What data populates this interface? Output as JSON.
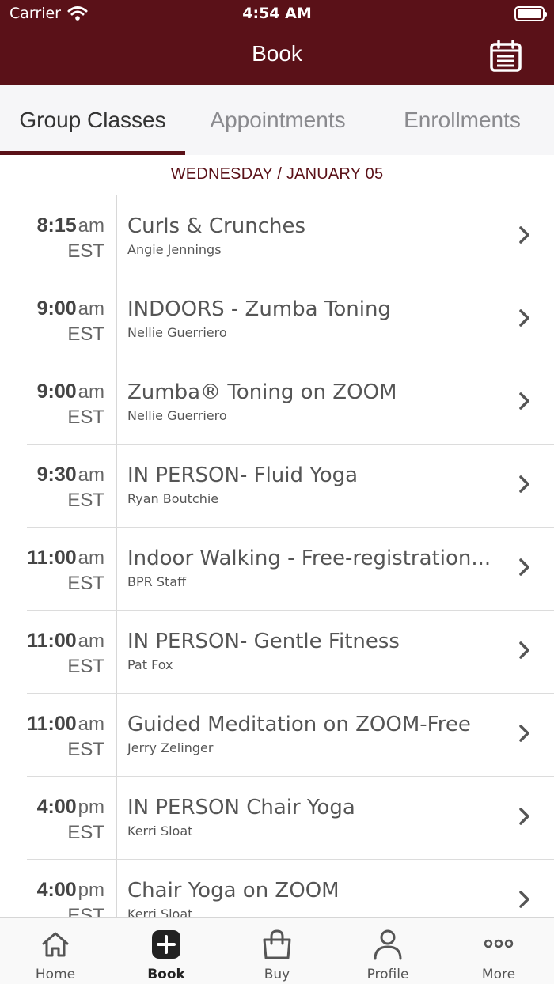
{
  "status_bar": {
    "carrier": "Carrier",
    "time": "4:54 AM"
  },
  "nav": {
    "title": "Book"
  },
  "tabs": [
    {
      "label": "Group Classes",
      "active": true
    },
    {
      "label": "Appointments",
      "active": false
    },
    {
      "label": "Enrollments",
      "active": false
    }
  ],
  "date_label": "WEDNESDAY / JANUARY 05",
  "classes": [
    {
      "time": "8:15",
      "ampm": "am",
      "tz": "EST",
      "name": "Curls & Crunches",
      "instructor": "Angie Jennings"
    },
    {
      "time": "9:00",
      "ampm": "am",
      "tz": "EST",
      "name": "INDOORS - Zumba Toning",
      "instructor": "Nellie Guerriero"
    },
    {
      "time": "9:00",
      "ampm": "am",
      "tz": "EST",
      "name": "Zumba® Toning on ZOOM",
      "instructor": "Nellie Guerriero"
    },
    {
      "time": "9:30",
      "ampm": "am",
      "tz": "EST",
      "name": "IN PERSON- Fluid Yoga",
      "instructor": "Ryan Boutchie"
    },
    {
      "time": "11:00",
      "ampm": "am",
      "tz": "EST",
      "name": "Indoor Walking - Free-registration...",
      "instructor": "BPR Staff"
    },
    {
      "time": "11:00",
      "ampm": "am",
      "tz": "EST",
      "name": "IN PERSON- Gentle Fitness",
      "instructor": "Pat Fox"
    },
    {
      "time": "11:00",
      "ampm": "am",
      "tz": "EST",
      "name": "Guided Meditation on ZOOM-Free",
      "instructor": "Jerry Zelinger"
    },
    {
      "time": "4:00",
      "ampm": "pm",
      "tz": "EST",
      "name": "IN PERSON Chair Yoga",
      "instructor": "Kerri Sloat"
    },
    {
      "time": "4:00",
      "ampm": "pm",
      "tz": "EST",
      "name": "Chair Yoga on ZOOM",
      "instructor": "Kerri Sloat"
    }
  ],
  "tabbar": [
    {
      "label": "Home",
      "icon": "home-icon",
      "active": false
    },
    {
      "label": "Book",
      "icon": "plus-square-icon",
      "active": true
    },
    {
      "label": "Buy",
      "icon": "shopping-bag-icon",
      "active": false
    },
    {
      "label": "Profile",
      "icon": "person-icon",
      "active": false
    },
    {
      "label": "More",
      "icon": "more-dots-icon",
      "active": false
    }
  ],
  "colors": {
    "brand": "#5a1118",
    "tab_bg": "#f6f6f8"
  }
}
